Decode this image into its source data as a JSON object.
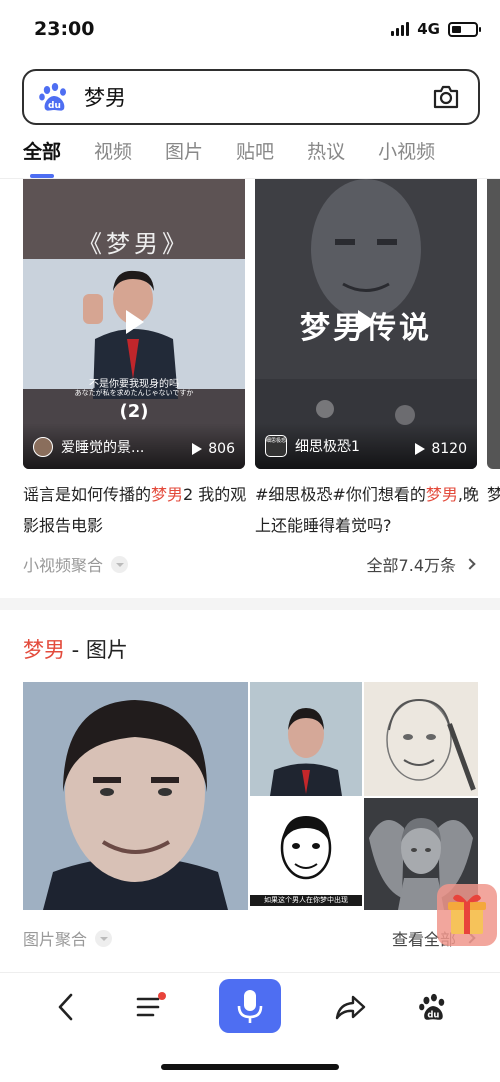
{
  "status_bar": {
    "time": "23:00",
    "network": "4G",
    "battery_level": 0.4
  },
  "search": {
    "query": "梦男",
    "logo_icon": "baidu-paw-icon",
    "camera_icon": "camera-icon"
  },
  "tabs": [
    {
      "label": "全部",
      "active": true
    },
    {
      "label": "视频",
      "active": false
    },
    {
      "label": "图片",
      "active": false
    },
    {
      "label": "贴吧",
      "active": false
    },
    {
      "label": "热议",
      "active": false
    },
    {
      "label": "小视频",
      "active": false
    }
  ],
  "videos": [
    {
      "thumb_title": "《梦男》",
      "thumb_subtitle": "不是你要我现身的吗",
      "thumb_subtitle_jp": "あなたが私を求めたんじゃないですか",
      "thumb_episode": "(2)",
      "author": "爱睡觉的景...",
      "plays": "806",
      "title_pre": "谣言是如何传播的",
      "title_hl": "梦男",
      "title_post": "2 我的观影报告电影"
    },
    {
      "thumb_title": "梦男传说",
      "author_badge": "细思极恐",
      "author": "细思极恐1",
      "plays": "8120",
      "title_pre": "#细思极恐#你们想看的",
      "title_hl": "梦男",
      "title_post": ",晚上还能睡得着觉吗?"
    },
    {
      "title_pre": "梦"
    }
  ],
  "video_footer": {
    "source": "小视频聚合",
    "all_label": "全部7.4万条"
  },
  "images_section": {
    "title_hl": "梦男",
    "title_rest": " - 图片",
    "caption_small": "如果这个男人在你梦中出现",
    "source": "图片聚合",
    "all_label": "查看全部"
  },
  "bottom_nav": {
    "items": [
      "back-icon",
      "menu-icon",
      "microphone-icon",
      "share-icon",
      "baidu-paw-icon"
    ],
    "notification_dot": true
  },
  "colors": {
    "accent": "#4e6ef2",
    "highlight": "#e34b3c",
    "notify": "#e8433b"
  }
}
